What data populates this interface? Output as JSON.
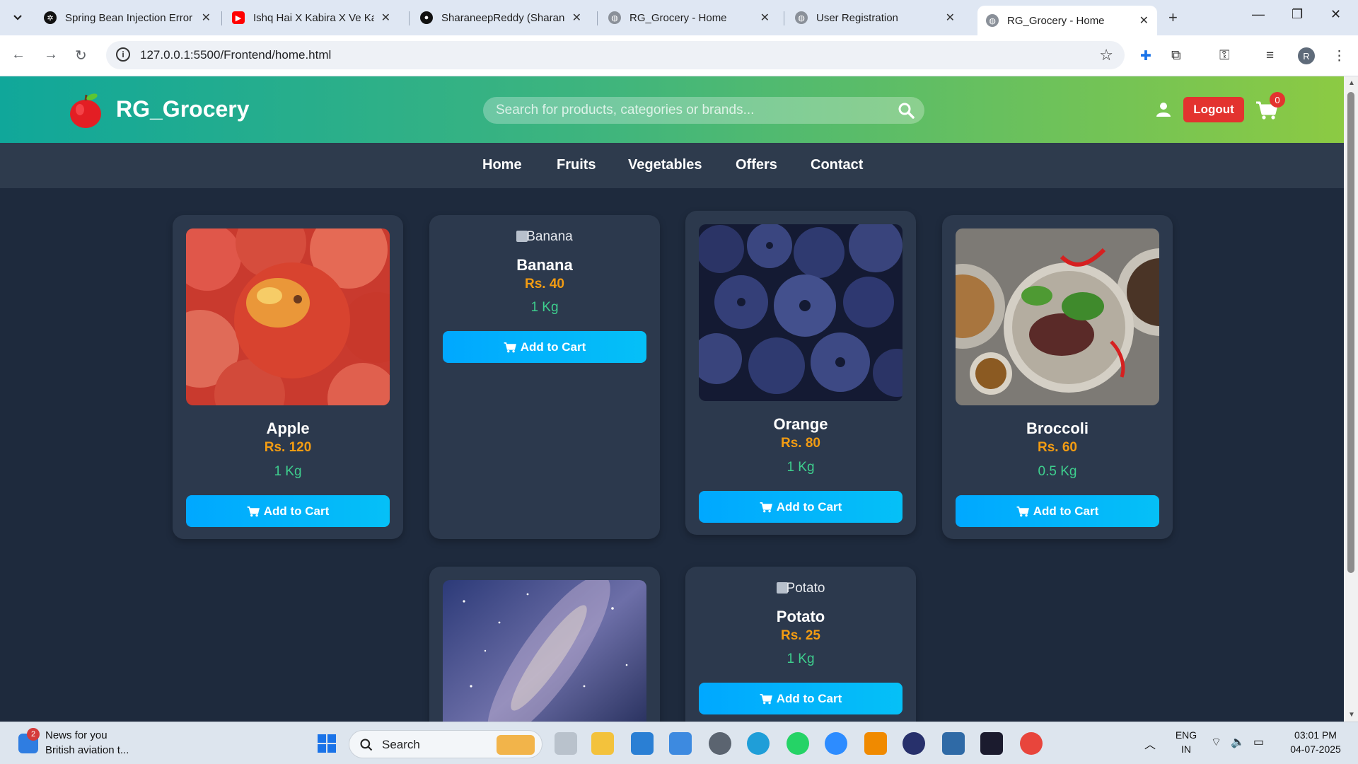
{
  "browser": {
    "tabs": [
      {
        "title": "Spring Bean Injection Error",
        "active": false
      },
      {
        "title": "Ishq Hai X Kabira X Ve Kam",
        "active": false
      },
      {
        "title": "SharaneepReddy (Sharane",
        "active": false
      },
      {
        "title": "RG_Grocery - Home",
        "active": false
      },
      {
        "title": "User Registration",
        "active": false
      },
      {
        "title": "RG_Grocery - Home",
        "active": true
      }
    ],
    "url": "127.0.0.1:5500/Frontend/home.html",
    "profile_initial": "R"
  },
  "site": {
    "brand": "RG_Grocery",
    "search_placeholder": "Search for products, categories or brands...",
    "logout_label": "Logout",
    "cart_count": "0",
    "nav": [
      "Home",
      "Fruits",
      "Vegetables",
      "Offers",
      "Contact"
    ]
  },
  "products": [
    {
      "name": "Apple",
      "price": "Rs. 120",
      "qty": "1 Kg",
      "image": "apples",
      "alt": "",
      "button": "Add to Cart"
    },
    {
      "name": "Banana",
      "price": "Rs. 40",
      "qty": "1 Kg",
      "image": "broken",
      "alt": "Banana",
      "button": "Add to Cart"
    },
    {
      "name": "Orange",
      "price": "Rs. 80",
      "qty": "1 Kg",
      "image": "blueberries",
      "alt": "",
      "button": "Add to Cart"
    },
    {
      "name": "Broccoli",
      "price": "Rs. 60",
      "qty": "0.5 Kg",
      "image": "food-plate",
      "alt": "",
      "button": "Add to Cart"
    },
    {
      "name": "",
      "price": "",
      "qty": "",
      "image": "night-sky",
      "alt": "",
      "button": ""
    },
    {
      "name": "Potato",
      "price": "Rs. 25",
      "qty": "1 Kg",
      "image": "broken",
      "alt": "Potato",
      "button": "Add to Cart"
    }
  ],
  "taskbar": {
    "news_badge": "2",
    "news_title": "News for you",
    "news_subtitle": "British aviation t...",
    "search_label": "Search",
    "lang": "ENG",
    "region": "IN",
    "time": "03:01 PM",
    "date": "04-07-2025"
  },
  "colors": {
    "header_gradient_start": "#10a79a",
    "header_gradient_end": "#8cca43",
    "page_bg": "#1e2a3d",
    "card_bg": "#2c394d",
    "price": "#f39c12",
    "qty": "#3ecf8e",
    "button": "#00a8ff",
    "logout": "#e3332f"
  }
}
